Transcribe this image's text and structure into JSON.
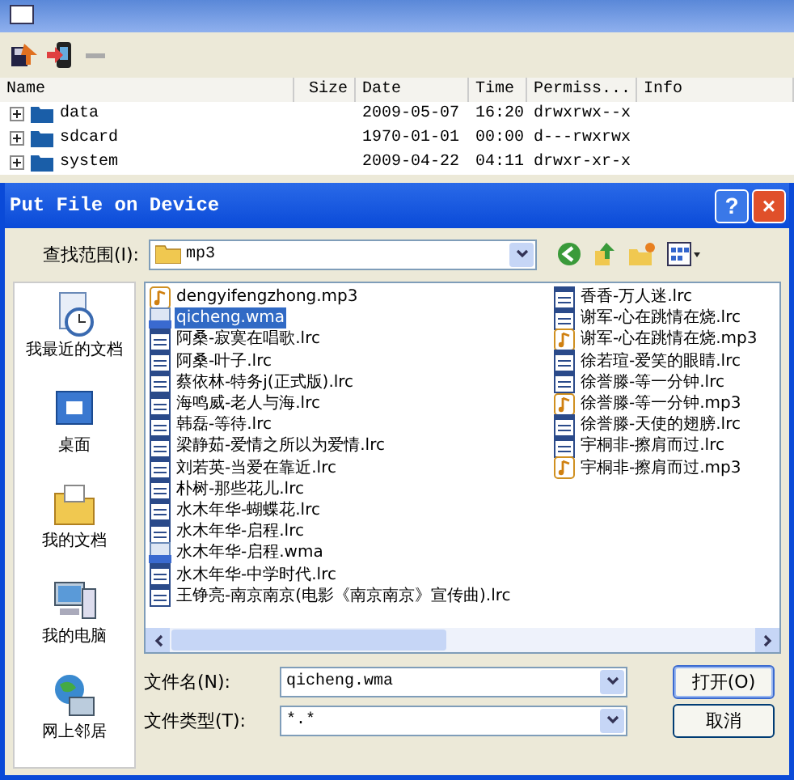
{
  "table": {
    "columns": [
      "Name",
      "Size",
      "Date",
      "Time",
      "Permiss...",
      "Info"
    ],
    "rows": [
      {
        "name": "data",
        "size": "",
        "date": "2009-05-07",
        "time": "16:20",
        "perm": "drwxrwx--x",
        "expanded": false
      },
      {
        "name": "sdcard",
        "size": "",
        "date": "1970-01-01",
        "time": "00:00",
        "perm": "d---rwxrwx",
        "expanded": false
      },
      {
        "name": "system",
        "size": "",
        "date": "2009-04-22",
        "time": "04:11",
        "perm": "drwxr-xr-x",
        "expanded": false
      }
    ]
  },
  "dialog": {
    "title": "Put File on Device",
    "help": "?",
    "close": "×",
    "look_in_label": "查找范围(I):",
    "look_in_value": "mp3",
    "places": [
      {
        "label": "我最近的文档",
        "kind": "recent"
      },
      {
        "label": "桌面",
        "kind": "desktop"
      },
      {
        "label": "我的文档",
        "kind": "documents"
      },
      {
        "label": "我的电脑",
        "kind": "computer"
      },
      {
        "label": "网上邻居",
        "kind": "network"
      }
    ],
    "files": [
      {
        "name": "dengyifengzhong.mp3",
        "kind": "mp3",
        "selected": false
      },
      {
        "name": "qicheng.wma",
        "kind": "wma",
        "selected": true
      },
      {
        "name": "阿桑-寂寞在唱歌.lrc",
        "kind": "lrc",
        "selected": false
      },
      {
        "name": "阿桑-叶子.lrc",
        "kind": "lrc",
        "selected": false
      },
      {
        "name": "蔡依林-特务j(正式版).lrc",
        "kind": "lrc",
        "selected": false
      },
      {
        "name": "海鸣威-老人与海.lrc",
        "kind": "lrc",
        "selected": false
      },
      {
        "name": "韩磊-等待.lrc",
        "kind": "lrc",
        "selected": false
      },
      {
        "name": "梁静茹-爱情之所以为爱情.lrc",
        "kind": "lrc",
        "selected": false
      },
      {
        "name": "刘若英-当爱在靠近.lrc",
        "kind": "lrc",
        "selected": false
      },
      {
        "name": "朴树-那些花儿.lrc",
        "kind": "lrc",
        "selected": false
      },
      {
        "name": "水木年华-蝴蝶花.lrc",
        "kind": "lrc",
        "selected": false
      },
      {
        "name": "水木年华-启程.lrc",
        "kind": "lrc",
        "selected": false
      },
      {
        "name": "水木年华-启程.wma",
        "kind": "wma",
        "selected": false
      },
      {
        "name": "水木年华-中学时代.lrc",
        "kind": "lrc",
        "selected": false
      },
      {
        "name": "王铮亮-南京南京(电影《南京南京》宣传曲).lrc",
        "kind": "lrc",
        "selected": false
      },
      {
        "name": "香香-万人迷.lrc",
        "kind": "lrc",
        "selected": false
      },
      {
        "name": "谢军-心在跳情在烧.lrc",
        "kind": "lrc",
        "selected": false
      },
      {
        "name": "谢军-心在跳情在烧.mp3",
        "kind": "mp3",
        "selected": false
      },
      {
        "name": "徐若瑄-爱笑的眼睛.lrc",
        "kind": "lrc",
        "selected": false
      },
      {
        "name": "徐誉滕-等一分钟.lrc",
        "kind": "lrc",
        "selected": false
      },
      {
        "name": "徐誉滕-等一分钟.mp3",
        "kind": "mp3",
        "selected": false
      },
      {
        "name": "徐誉滕-天使的翅膀.lrc",
        "kind": "lrc",
        "selected": false
      },
      {
        "name": "宇桐非-擦肩而过.lrc",
        "kind": "lrc",
        "selected": false
      },
      {
        "name": "宇桐非-擦肩而过.mp3",
        "kind": "mp3",
        "selected": false
      }
    ],
    "file_name_label": "文件名(N):",
    "file_name_value": "qicheng.wma",
    "file_type_label": "文件类型(T):",
    "file_type_value": "*.*",
    "open_button": "打开(O)",
    "cancel_button": "取消"
  }
}
